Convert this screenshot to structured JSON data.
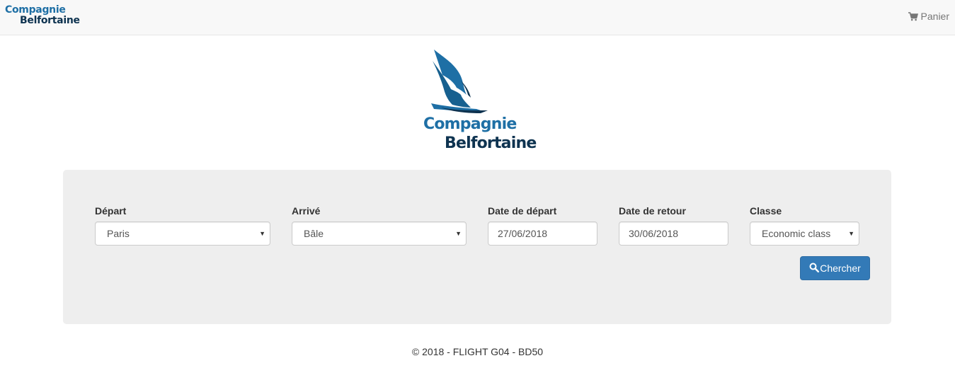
{
  "navbar": {
    "brand_line1": "Compagnie",
    "brand_line2": "Belfortaine",
    "cart_label": "Panier",
    "cart_icon": "shopping-cart-icon"
  },
  "logo": {
    "line1": "Compagnie",
    "line2": "Belfortaine",
    "colors": {
      "light": "#1e6fa5",
      "dark": "#0e3350"
    }
  },
  "search": {
    "departure": {
      "label": "Départ",
      "value": "Paris"
    },
    "arrival": {
      "label": "Arrivé",
      "value": "Bâle"
    },
    "departure_date": {
      "label": "Date de départ",
      "value": "27/06/2018"
    },
    "return_date": {
      "label": "Date de retour",
      "value": "30/06/2018"
    },
    "class": {
      "label": "Classe",
      "value": "Economic class"
    },
    "submit_label": "Chercher",
    "submit_icon": "search-icon",
    "accent_color": "#337ab7"
  },
  "footer": {
    "text": "© 2018 - FLIGHT G04 - BD50"
  }
}
